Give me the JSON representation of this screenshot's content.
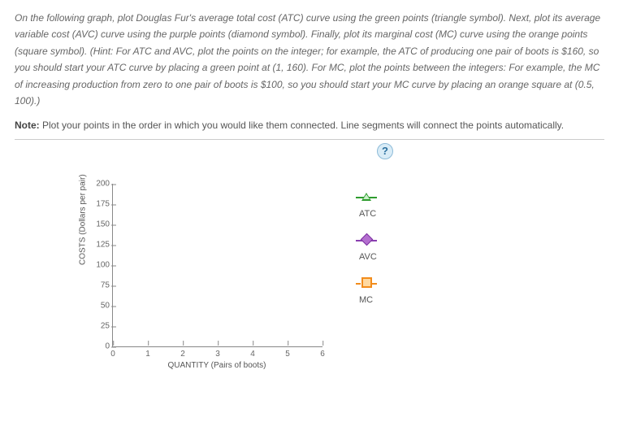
{
  "instructions": {
    "p1": "On the following graph, plot Douglas Fur's average total cost (ATC) curve using the green points (triangle symbol). Next, plot its average variable cost (AVC) curve using the purple points (diamond symbol). Finally, plot its marginal cost (MC) curve using the orange points (square symbol). (Hint: For ATC and AVC, plot the points on the integer; for example, the ATC of producing one pair of boots is $160, so you should start your ATC curve by placing a green point at (1, 160). For MC, plot the points between the integers: For example, the MC of increasing production from zero to one pair of boots is $100, so you should start your MC curve by placing an orange square at (0.5, 100).)",
    "note_label": "Note:",
    "note_text": " Plot your points in the order in which you would like them connected. Line segments will connect the points automatically."
  },
  "help": {
    "glyph": "?"
  },
  "legend": {
    "atc": "ATC",
    "avc": "AVC",
    "mc": "MC"
  },
  "chart_data": {
    "type": "scatter",
    "title": "",
    "xlabel": "QUANTITY (Pairs of boots)",
    "ylabel": "COSTS (Dollars per pair)",
    "xlim": [
      0,
      6
    ],
    "ylim": [
      0,
      200
    ],
    "xticks": [
      0,
      1,
      2,
      3,
      4,
      5,
      6
    ],
    "yticks": [
      0,
      25,
      50,
      75,
      100,
      125,
      150,
      175,
      200
    ],
    "series": [
      {
        "name": "ATC",
        "symbol": "triangle",
        "color": "#2e9c2e",
        "values": []
      },
      {
        "name": "AVC",
        "symbol": "diamond",
        "color": "#8a3fb0",
        "values": []
      },
      {
        "name": "MC",
        "symbol": "square",
        "color": "#f28c1c",
        "values": []
      }
    ]
  }
}
